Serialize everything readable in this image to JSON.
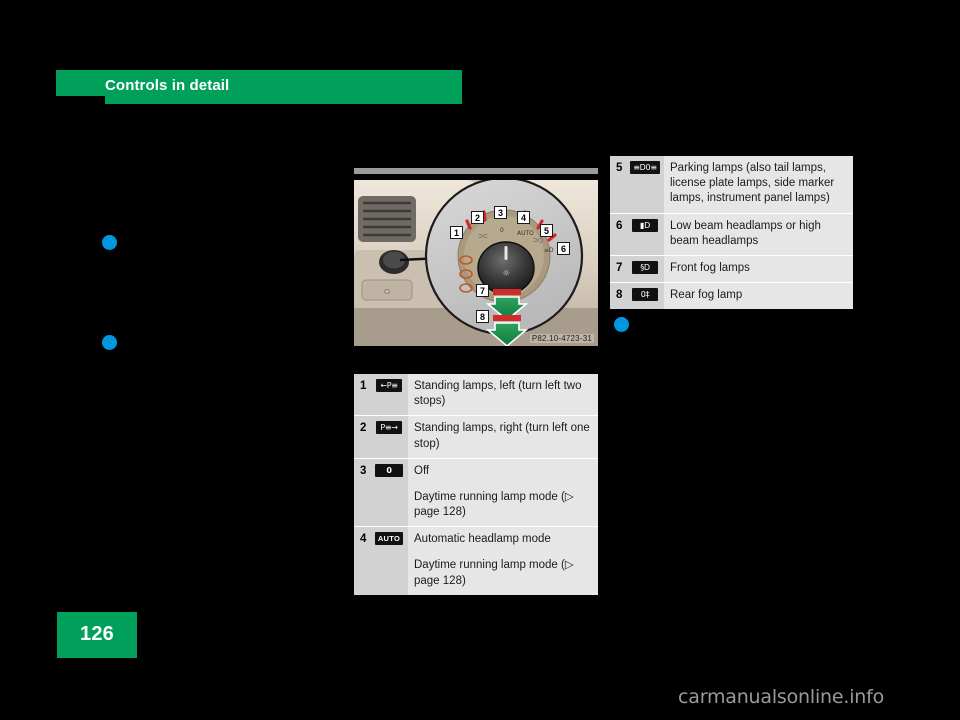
{
  "header": {
    "title": "Controls in detail"
  },
  "page": {
    "number": "126",
    "watermark": "carmanualsonline.info"
  },
  "figure": {
    "caption": "P82.10-4723-31",
    "alt_name": "light-switch-photo",
    "callouts": [
      "1",
      "2",
      "3",
      "4",
      "5",
      "6",
      "7",
      "8"
    ]
  },
  "colors": {
    "brand_green": "#00A05A",
    "bullet_blue": "#0097E0",
    "table_bg": "#E6E6E6",
    "table_num_bg": "#D2D2D2",
    "page_bg": "#000000",
    "watermark_gray": "#9A9A9A"
  },
  "table_right": {
    "name": "lamp-positions-table-upper",
    "rows": [
      {
        "num": "5",
        "icon_name": "parking-lamps-icon",
        "icon_glyph": "≡D0≡",
        "lines": [
          "Parking lamps (also tail lamps, license plate lamps, side marker lamps, instrument panel lamps)"
        ]
      },
      {
        "num": "6",
        "icon_name": "low-beam-headlamps-icon",
        "icon_glyph": "▮D",
        "lines": [
          "Low beam headlamps or high beam headlamps"
        ]
      },
      {
        "num": "7",
        "icon_name": "front-fog-lamps-icon",
        "icon_glyph": "§D",
        "lines": [
          "Front fog lamps"
        ]
      },
      {
        "num": "8",
        "icon_name": "rear-fog-lamp-icon",
        "icon_glyph": "0‡",
        "lines": [
          "Rear fog lamp"
        ]
      }
    ]
  },
  "table_bottom": {
    "name": "lamp-positions-table-lower",
    "rows": [
      {
        "num": "1",
        "icon_name": "standing-lamps-left-icon",
        "icon_glyph": "←P≡",
        "lines": [
          "Standing lamps, left (turn left two stops)"
        ]
      },
      {
        "num": "2",
        "icon_name": "standing-lamps-right-icon",
        "icon_glyph": "P≡→",
        "lines": [
          "Standing lamps, right (turn left one stop)"
        ]
      },
      {
        "num": "3",
        "icon_name": "off-position-icon",
        "icon_glyph": "0",
        "lines": [
          "Off",
          "Daytime running lamp mode (▷ page 128)"
        ]
      },
      {
        "num": "4",
        "icon_name": "automatic-headlamp-mode-icon",
        "icon_glyph": "AUTO",
        "lines": [
          "Automatic headlamp mode",
          "Daytime running lamp mode (▷ page 128)"
        ]
      }
    ]
  }
}
